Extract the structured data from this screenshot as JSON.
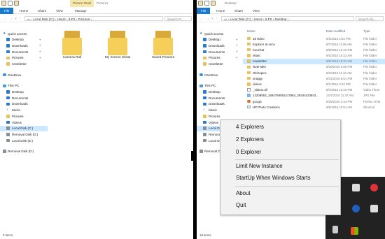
{
  "left_window": {
    "ribbon_tabs": [
      "File",
      "Home",
      "Share",
      "View",
      "Manage"
    ],
    "context_tab": "Picture Tools",
    "title": "Pictures",
    "address": [
      "Local Disk (C:)",
      "Users",
      "ILFS",
      "Pictures"
    ],
    "search_placeholder": "Search Pi...",
    "nav": [
      {
        "label": "Quick access",
        "icon": "star-icon",
        "head": true
      },
      {
        "label": "Desktop",
        "icon": "desktop-icon",
        "pinned": true
      },
      {
        "label": "Downloads",
        "icon": "downloads-icon",
        "pinned": true
      },
      {
        "label": "Documents",
        "icon": "documents-icon",
        "pinned": true
      },
      {
        "label": "Pictures",
        "icon": "pictures-icon",
        "pinned": true
      },
      {
        "label": "newsletter",
        "icon": "folder-icon"
      },
      {
        "label": "OneDrive",
        "icon": "onedrive-icon",
        "head": true,
        "gap": true
      },
      {
        "label": "This PC",
        "icon": "pc-icon",
        "head": true,
        "gap": true
      },
      {
        "label": "Desktop",
        "icon": "desktop-icon"
      },
      {
        "label": "Documents",
        "icon": "documents-icon"
      },
      {
        "label": "Downloads",
        "icon": "downloads-icon"
      },
      {
        "label": "Music",
        "icon": "music-icon"
      },
      {
        "label": "Pictures",
        "icon": "pictures-icon"
      },
      {
        "label": "Videos",
        "icon": "videos-icon"
      },
      {
        "label": "Local Disk (C:)",
        "icon": "disk-icon",
        "selected": true
      },
      {
        "label": "Removal Disk (D:)",
        "icon": "disk-icon"
      },
      {
        "label": "Local Disk (E:)",
        "icon": "disk-icon"
      },
      {
        "label": "Removal Disk (D:)",
        "icon": "disk-icon",
        "head": true,
        "gap": true
      }
    ],
    "folders": [
      "Camera Roll",
      "My Screen Shots",
      "Saved Pictures"
    ],
    "status": "3 items"
  },
  "right_window": {
    "ribbon_tabs": [
      "File",
      "Home",
      "Share",
      "View"
    ],
    "title": "Desktop",
    "address": [
      "Local Disk (C:)",
      "Users",
      "ILFS",
      "Desktop"
    ],
    "search_placeholder": "Search De...",
    "columns": [
      "Name",
      "Date modified",
      "Type"
    ],
    "nav": [
      {
        "label": "Quick access",
        "icon": "star-icon",
        "head": true
      },
      {
        "label": "Desktop",
        "icon": "desktop-icon",
        "pinned": true
      },
      {
        "label": "Downloads",
        "icon": "downloads-icon",
        "pinned": true
      },
      {
        "label": "Documents",
        "icon": "documents-icon",
        "pinned": true
      },
      {
        "label": "Pictures",
        "icon": "pictures-icon",
        "pinned": true
      },
      {
        "label": "newsletter",
        "icon": "folder-icon"
      },
      {
        "label": "OneDrive",
        "icon": "onedrive-icon",
        "head": true,
        "gap": true
      },
      {
        "label": "This PC",
        "icon": "pc-icon",
        "head": true,
        "gap": true
      },
      {
        "label": "Desktop",
        "icon": "desktop-icon"
      },
      {
        "label": "Documents",
        "icon": "documents-icon"
      },
      {
        "label": "Downloads",
        "icon": "downloads-icon"
      },
      {
        "label": "Music",
        "icon": "music-icon"
      },
      {
        "label": "Pictures",
        "icon": "pictures-icon"
      },
      {
        "label": "Videos",
        "icon": "videos-icon"
      },
      {
        "label": "Local Disk (C:)",
        "icon": "disk-icon",
        "selected": true
      },
      {
        "label": "Removal Disk (D:)",
        "icon": "disk-icon"
      },
      {
        "label": "Local Disk (E:)",
        "icon": "disk-icon"
      },
      {
        "label": "Removal Disk (D:)",
        "icon": "disk-icon",
        "head": true,
        "gap": true
      }
    ],
    "files": [
      {
        "name": "3d video",
        "date": "9/3/2016 4:54 PM",
        "type": "File folder",
        "kind": "folder"
      },
      {
        "name": "Explorer at once",
        "date": "8/7/2016 11:06 AM",
        "type": "File folder",
        "kind": "folder"
      },
      {
        "name": "Kouchat",
        "date": "8/5/2016 12:16 PM",
        "type": "File folder",
        "kind": "folder"
      },
      {
        "name": "Music",
        "date": "9/1/2016 10:22 AM",
        "type": "File folder",
        "kind": "folder"
      },
      {
        "name": "newsletter",
        "date": "9/6/2016 10:31 AM",
        "type": "File folder",
        "kind": "folder",
        "selected": true
      },
      {
        "name": "Note-take",
        "date": "8/29/2016 3:08 PM",
        "type": "File folder",
        "kind": "folder"
      },
      {
        "name": "Old topics",
        "date": "8/2/2016 11:10 AM",
        "type": "File folder",
        "kind": "folder"
      },
      {
        "name": "snaggy",
        "date": "8/31/2016 5:51 PM",
        "type": "File folder",
        "kind": "folder"
      },
      {
        "name": "videos",
        "date": "8/1/2016 3:24 PM",
        "type": "File folder",
        "kind": "folder"
      },
      {
        "name": "_videos.all",
        "date": "8/4/2016 12:10 PM",
        "type": "Video Thum",
        "kind": "doc"
      },
      {
        "name": "12208553_1684758081417884_29344423843...",
        "date": "12/7/2015 11:47 AM",
        "type": "JPG File",
        "kind": "img"
      },
      {
        "name": "googlc",
        "date": "8/29/2016 3:34 PM",
        "type": "Firefox HTM",
        "kind": "ff"
      },
      {
        "name": "HP Photo Creations",
        "date": "9/6/2016 10:51 AM",
        "type": "Shortcut",
        "kind": "sc"
      }
    ],
    "status": "18 items"
  },
  "context_menu": {
    "items": [
      "4 Explorers",
      "2 Explorers",
      "0 Explorer",
      "Limit New Instance",
      "StartUp When Windows Starts",
      "About",
      "Quit"
    ]
  },
  "colors": {
    "accent": "#1979ca",
    "selection": "#cce8ff",
    "folder": "#f6cf5a",
    "context_tab": "#f6e7b0"
  }
}
